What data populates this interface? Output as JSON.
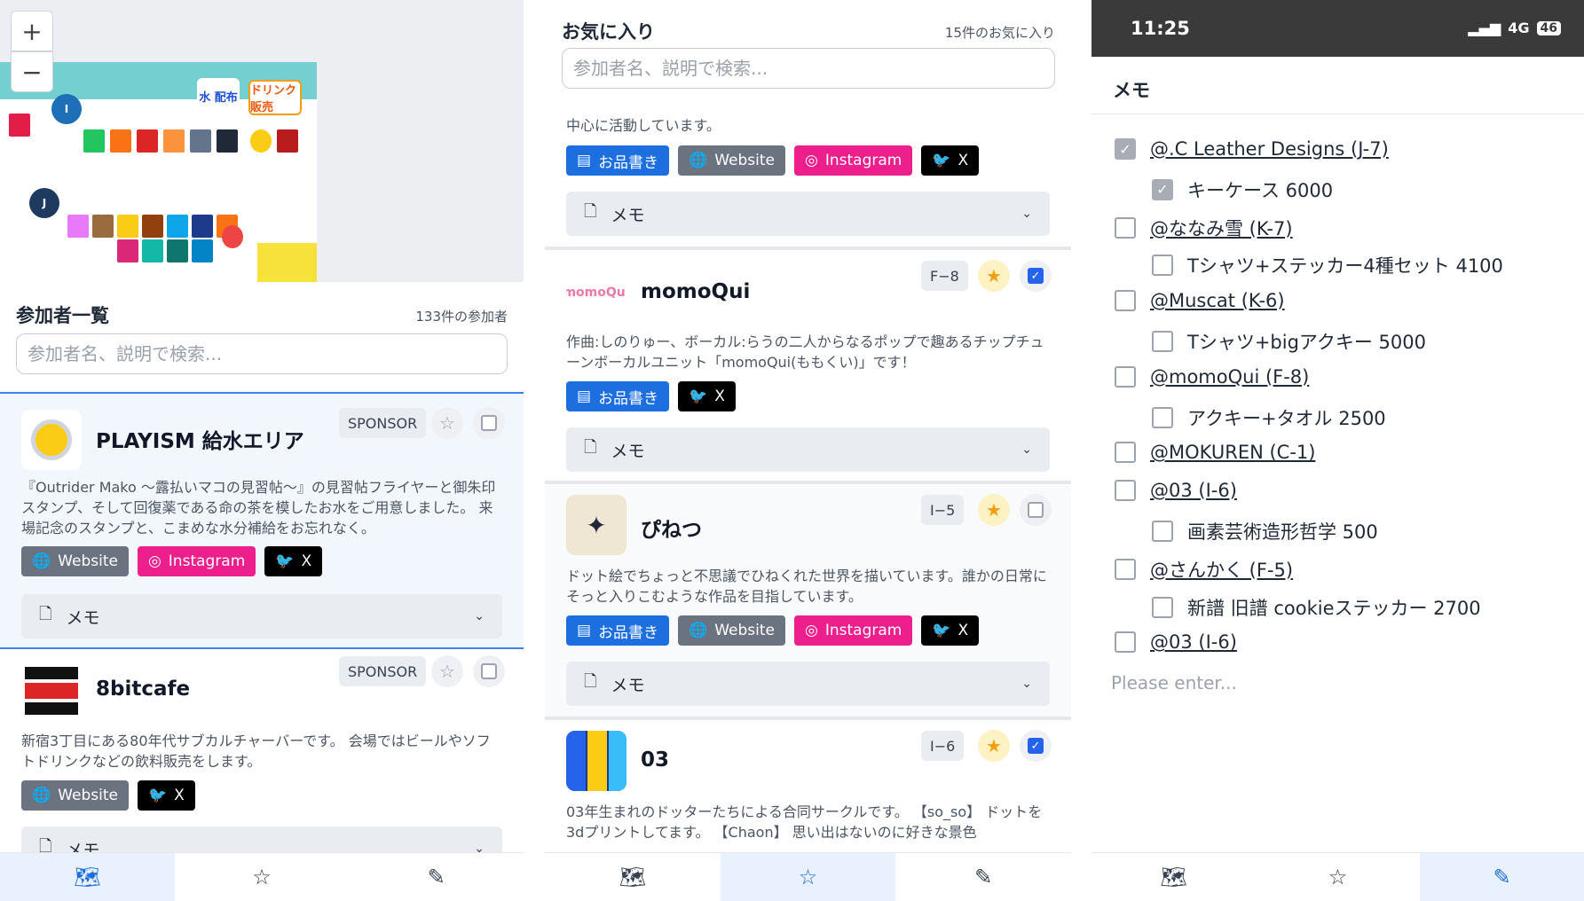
{
  "panel1": {
    "map": {
      "zone_i": "I",
      "zone_j": "J",
      "water_label": "水 配布",
      "drink_label": "ドリンク 販売",
      "zoom_in": "+",
      "zoom_out": "−"
    },
    "list_title": "参加者一覧",
    "list_count": "133件の参加者",
    "search_placeholder": "参加者名、説明で検索...",
    "cards": [
      {
        "name": "PLAYISM 給水エリア",
        "badge": "SPONSOR",
        "desc": "『Outrider Mako ～露払いマコの見習帖～』の見習帖フライヤーと御朱印スタンプ、そして回復薬である命の茶を模したお水をご用意しました。 来場記念のスタンプと、こまめな水分補給をお忘れなく。",
        "chips": [
          "Website",
          "Instagram",
          "X"
        ],
        "memo": "メモ"
      },
      {
        "name": "8bitcafe",
        "badge": "SPONSOR",
        "desc": "新宿3丁目にある80年代サブカルチャーバーです。 会場ではビールやソフトドリンクなどの飲料販売をします。",
        "chips": [
          "Website",
          "X"
        ],
        "memo": "メモ"
      }
    ]
  },
  "panel2": {
    "title": "お気に入り",
    "count": "15件のお気に入り",
    "search_placeholder": "参加者名、説明で検索...",
    "partial_desc": "中心に活動しています。",
    "partial_chips": [
      "お品書き",
      "Website",
      "Instagram",
      "X"
    ],
    "cards": [
      {
        "name": "momoQui",
        "booth": "F−8",
        "desc": "作曲:しのりゅー、ボーカル:らうの二人からなるポップで趣あるチップチューンボーカルユニット「momoQui(ももくい)」です！",
        "chips": [
          "お品書き",
          "X"
        ],
        "memo": "メモ"
      },
      {
        "name": "ぴねつ",
        "booth": "I−5",
        "desc": "ドット絵でちょっと不思議でひねくれた世界を描いています。誰かの日常にそっと入りこむような作品を目指しています。",
        "chips": [
          "お品書き",
          "Website",
          "Instagram",
          "X"
        ],
        "memo": "メモ"
      },
      {
        "name": "03",
        "booth": "I−6",
        "desc": "03年生まれのドッターたちによる合同サークルです。 【so_so】 ドットを3dプリントしてます。 【Chaon】 思い出はないのに好きな景色"
      }
    ]
  },
  "panel3": {
    "status_time": "11:25",
    "status_network": "4G",
    "status_battery": "46",
    "title": "メモ",
    "items": [
      {
        "text": "@.C Leather Designs (J-7)",
        "checked": true,
        "link": true
      },
      {
        "text": "キーケース 6000",
        "checked": true,
        "link": false
      },
      {
        "text": "@ななみ雪 (K-7)",
        "checked": false,
        "link": true
      },
      {
        "text": "Tシャツ+ステッカー4種セット 4100",
        "checked": false,
        "link": false
      },
      {
        "text": "@Muscat (K-6)",
        "checked": false,
        "link": true
      },
      {
        "text": "Tシャツ+bigアクキー 5000",
        "checked": false,
        "link": false
      },
      {
        "text": "@momoQui (F-8)",
        "checked": false,
        "link": true
      },
      {
        "text": "アクキー+タオル 2500",
        "checked": false,
        "link": false
      },
      {
        "text": "@MOKUREN (C-1)",
        "checked": false,
        "link": true
      },
      {
        "text": "@03 (I-6)",
        "checked": false,
        "link": true
      },
      {
        "text": "画素芸術造形哲学 500",
        "checked": false,
        "link": false
      },
      {
        "text": "@さんかく (F-5)",
        "checked": false,
        "link": true
      },
      {
        "text": "新譜 旧譜 cookieステッカー 2700",
        "checked": false,
        "link": false
      },
      {
        "text": "@03 (I-6)",
        "checked": false,
        "link": true
      }
    ],
    "placeholder": "Please enter..."
  },
  "icons": {
    "map": "map-icon",
    "star": "star-icon",
    "memo": "memo-edit-icon",
    "globe": "globe-icon",
    "instagram": "instagram-icon",
    "x": "x-logo-icon",
    "menu": "menu-book-icon",
    "doc": "document-icon",
    "chevron": "chevron-down-icon"
  },
  "colors": {
    "accent": "#1d6fe0",
    "instagram": "#ec1f8d",
    "sponsor_bg": "#f2f7fd",
    "star_active": "#f59e0b"
  }
}
